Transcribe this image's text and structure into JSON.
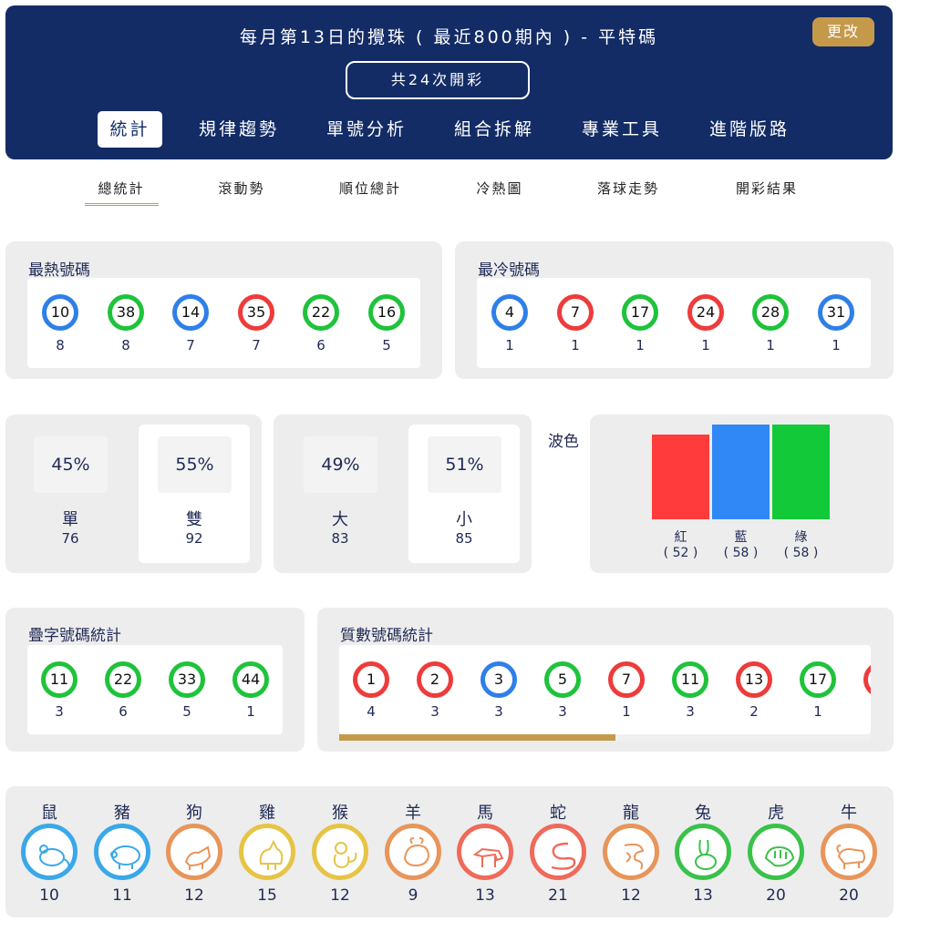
{
  "header": {
    "title": "每月第13日的攪珠 ( 最近800期內 ) - 平特碼",
    "change_label": "更改",
    "count_label": "共24次開彩",
    "tabs": [
      "統計",
      "規律趨勢",
      "單號分析",
      "組合拆解",
      "專業工具",
      "進階版路"
    ]
  },
  "sub_tabs": [
    "總統計",
    "滾動勢",
    "順位總計",
    "冷熱圖",
    "落球走勢",
    "開彩結果"
  ],
  "hot": {
    "title": "最熱號碼",
    "balls": [
      {
        "num": "10",
        "color": "blue",
        "count": "8"
      },
      {
        "num": "38",
        "color": "green",
        "count": "8"
      },
      {
        "num": "14",
        "color": "blue",
        "count": "7"
      },
      {
        "num": "35",
        "color": "red",
        "count": "7"
      },
      {
        "num": "22",
        "color": "green",
        "count": "6"
      },
      {
        "num": "16",
        "color": "green",
        "count": "5"
      }
    ]
  },
  "cold": {
    "title": "最冷號碼",
    "balls": [
      {
        "num": "4",
        "color": "blue",
        "count": "1"
      },
      {
        "num": "7",
        "color": "red",
        "count": "1"
      },
      {
        "num": "17",
        "color": "green",
        "count": "1"
      },
      {
        "num": "24",
        "color": "red",
        "count": "1"
      },
      {
        "num": "28",
        "color": "green",
        "count": "1"
      },
      {
        "num": "31",
        "color": "blue",
        "count": "1"
      }
    ]
  },
  "odd_even": [
    {
      "pct": "45%",
      "label": "單",
      "count": "76"
    },
    {
      "pct": "55%",
      "label": "雙",
      "count": "92"
    }
  ],
  "big_small": [
    {
      "pct": "49%",
      "label": "大",
      "count": "83"
    },
    {
      "pct": "51%",
      "label": "小",
      "count": "85"
    }
  ],
  "wave": {
    "title": "波色",
    "chart_data": {
      "type": "bar",
      "categories": [
        "紅",
        "藍",
        "綠"
      ],
      "values": [
        52,
        58,
        58
      ],
      "value_labels": [
        "( 52 )",
        "( 58 )",
        "( 58 )"
      ],
      "colors": [
        "#ff3b3b",
        "#2f88f5",
        "#12c93a"
      ]
    }
  },
  "repeat": {
    "title": "疊字號碼統計",
    "balls": [
      {
        "num": "11",
        "color": "green",
        "count": "3"
      },
      {
        "num": "22",
        "color": "green",
        "count": "6"
      },
      {
        "num": "33",
        "color": "green",
        "count": "5"
      },
      {
        "num": "44",
        "color": "green",
        "count": "1"
      }
    ]
  },
  "prime": {
    "title": "質數號碼統計",
    "balls": [
      {
        "num": "1",
        "color": "red",
        "count": "4"
      },
      {
        "num": "2",
        "color": "red",
        "count": "3"
      },
      {
        "num": "3",
        "color": "blue",
        "count": "3"
      },
      {
        "num": "5",
        "color": "green",
        "count": "3"
      },
      {
        "num": "7",
        "color": "red",
        "count": "1"
      },
      {
        "num": "11",
        "color": "green",
        "count": "3"
      },
      {
        "num": "13",
        "color": "red",
        "count": "2"
      },
      {
        "num": "17",
        "color": "green",
        "count": "1"
      }
    ]
  },
  "zodiac": [
    {
      "name": "鼠",
      "count": "10",
      "icon": "rat-icon",
      "color": "#3aa8e8"
    },
    {
      "name": "豬",
      "count": "11",
      "icon": "pig-icon",
      "color": "#3aa8e8"
    },
    {
      "name": "狗",
      "count": "12",
      "icon": "dog-icon",
      "color": "#e8955a"
    },
    {
      "name": "雞",
      "count": "15",
      "icon": "rooster-icon",
      "color": "#e6c445"
    },
    {
      "name": "猴",
      "count": "12",
      "icon": "monkey-icon",
      "color": "#e6c445"
    },
    {
      "name": "羊",
      "count": "9",
      "icon": "goat-icon",
      "color": "#e8955a"
    },
    {
      "name": "馬",
      "count": "13",
      "icon": "horse-icon",
      "color": "#ef6a5a"
    },
    {
      "name": "蛇",
      "count": "21",
      "icon": "snake-icon",
      "color": "#ef6a5a"
    },
    {
      "name": "龍",
      "count": "12",
      "icon": "dragon-icon",
      "color": "#e8955a"
    },
    {
      "name": "兔",
      "count": "13",
      "icon": "rabbit-icon",
      "color": "#39c24a"
    },
    {
      "name": "虎",
      "count": "20",
      "icon": "tiger-icon",
      "color": "#39c24a"
    },
    {
      "name": "牛",
      "count": "20",
      "icon": "ox-icon",
      "color": "#e8955a"
    }
  ]
}
